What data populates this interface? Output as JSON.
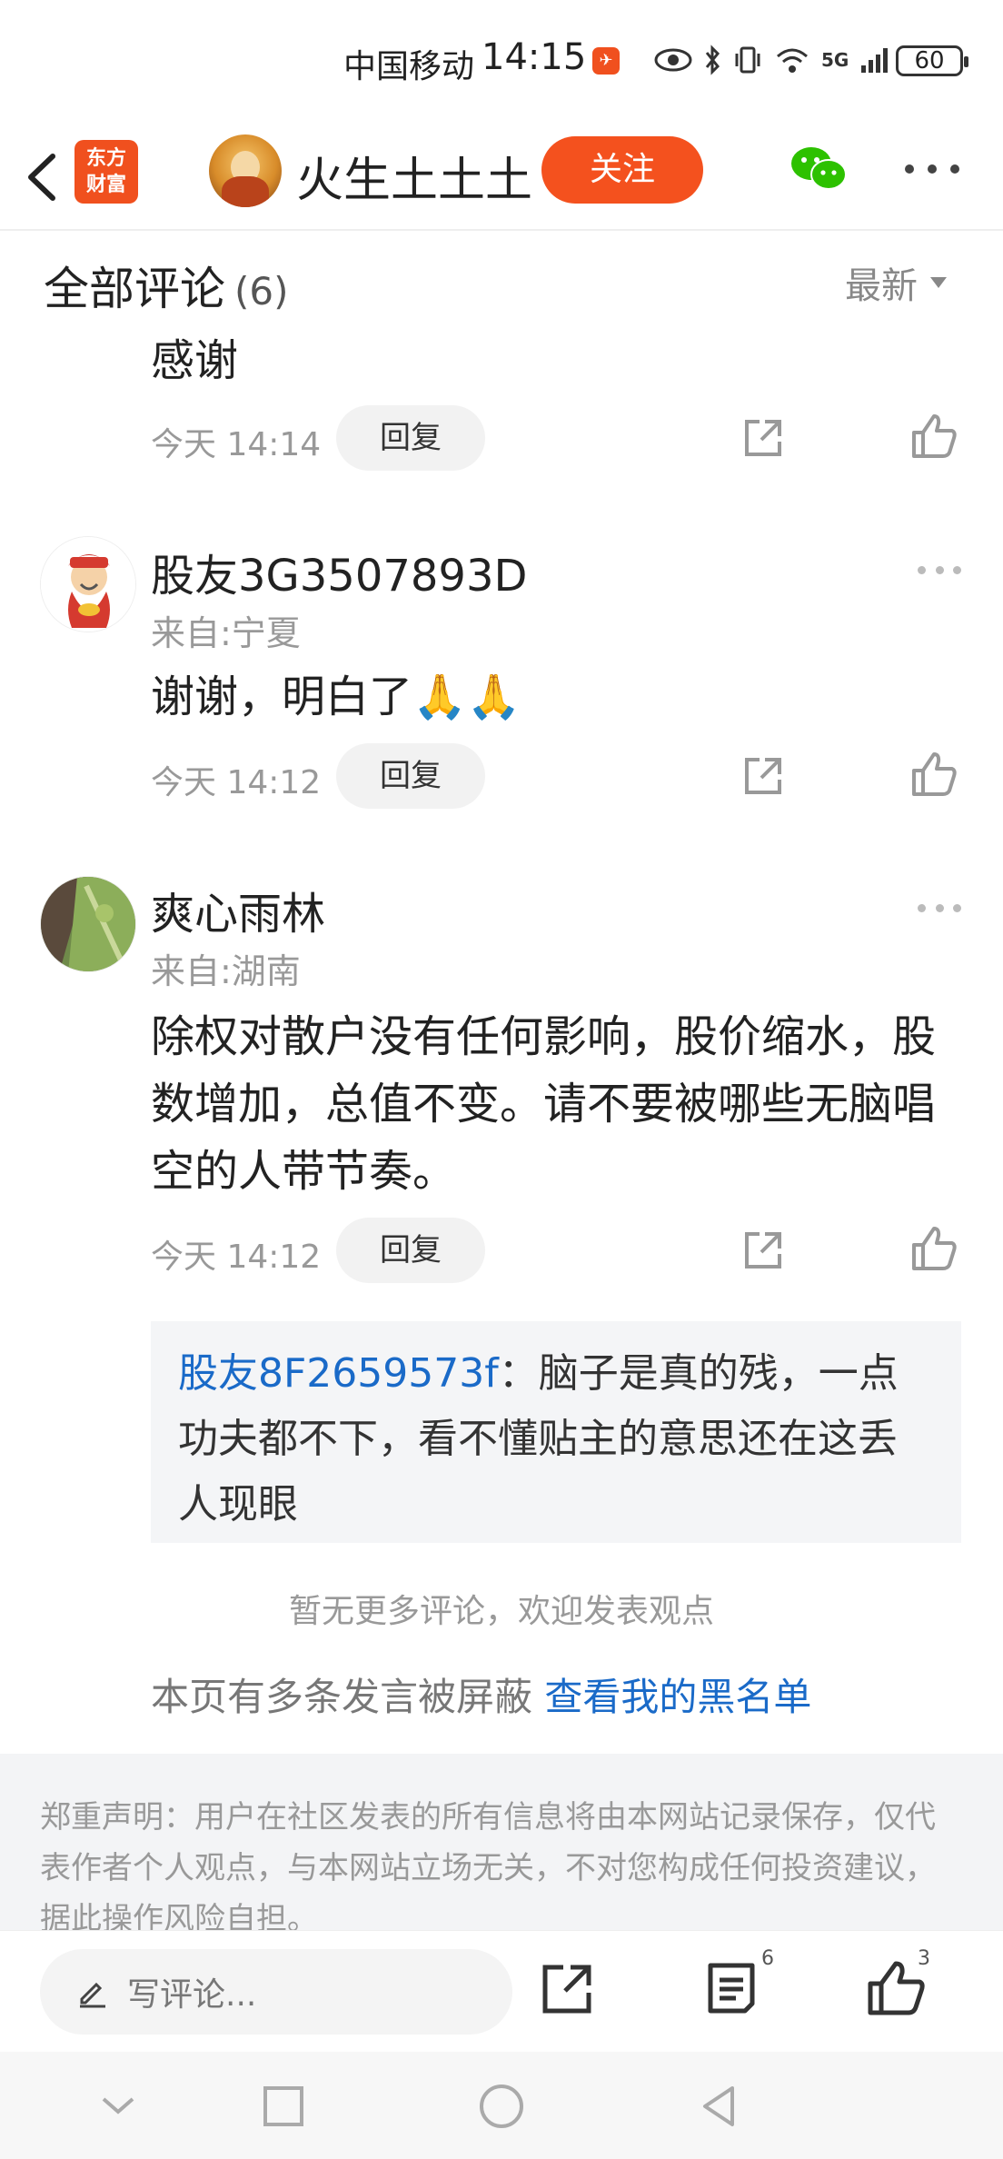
{
  "status_bar": {
    "carrier": "中国移动",
    "time": "14:15",
    "network": "5G",
    "battery": "60"
  },
  "header": {
    "brand_logo_line1": "东方",
    "brand_logo_line2": "财富",
    "author_name": "火生土土土",
    "follow_label": "关注",
    "accent_color": "#f4511e"
  },
  "comments": {
    "title": "全部评论",
    "count": "(6)",
    "sort_label": "最新",
    "items": [
      {
        "body": "感谢",
        "time": "今天 14:14",
        "reply_label": "回复"
      },
      {
        "user": "股友3G3507893D",
        "location": "来自:宁夏",
        "body": "谢谢，明白了🙏🙏",
        "time": "今天 14:12",
        "reply_label": "回复"
      },
      {
        "user": "爽心雨林",
        "location": "来自:湖南",
        "body": "除权对散户没有任何影响，股价缩水，股数增加，总值不变。请不要被哪些无脑唱空的人带节奏。",
        "time": "今天 14:12",
        "reply_label": "回复",
        "sub_reply": {
          "user": "股友8F2659573f",
          "text": "：脑子是真的残，一点功夫都不下，看不懂贴主的意思还在这丢人现眼"
        }
      }
    ],
    "no_more": "暂无更多评论，欢迎发表观点",
    "blocked_text": "本页有多条发言被屏蔽",
    "blocked_link": "查看我的黑名单"
  },
  "disclaimer": "郑重声明：用户在社区发表的所有信息将由本网站记录保存，仅代表作者个人观点，与本网站立场无关，不对您构成任何投资建议，据此操作风险自担。",
  "bottom_bar": {
    "input_placeholder": "写评论...",
    "comment_count": "6",
    "like_count": "3"
  },
  "icons": {
    "back": "back-arrow-icon",
    "wechat": "wechat-icon",
    "more": "more-icon",
    "share": "share-icon",
    "like": "thumbs-up-icon",
    "pen": "pen-icon",
    "comments": "comments-icon"
  }
}
